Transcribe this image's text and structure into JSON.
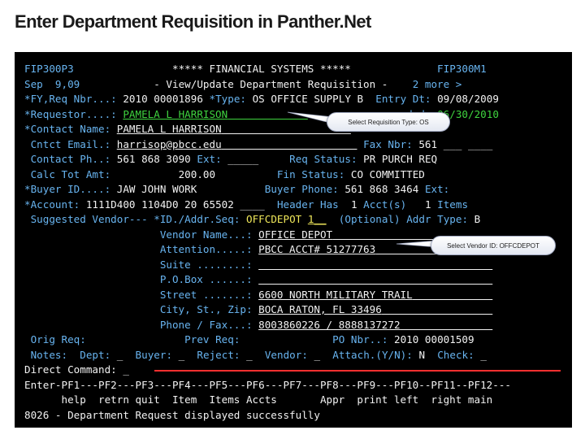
{
  "slide_title": "Enter Department Requisition in Panther.Net",
  "screen": {
    "line1": {
      "left": "FIP300P3",
      "title": "***** FINANCIAL SYSTEMS *****",
      "right": "FIP300M1"
    },
    "line2": {
      "date": "Sep  9,09",
      "title": "- View/Update Department Requisition -",
      "more": "2 more >"
    },
    "line3": {
      "label": "*FY,Req Nbr...:",
      "value": "2010 00001896",
      "type_label": "*Type:",
      "type_value": "OS OFFICE SUPPLY B",
      "entry_label": "Entry Dt:",
      "entry_value": "09/08/2009"
    },
    "line4": {
      "label": "*Requestor....:",
      "value": "PAMELA L HARRISON",
      "needed_label": "ded:",
      "needed_value": "06/30/2010"
    },
    "line5": {
      "label": "*Contact Name:",
      "value": "PAMELA L HARRISON"
    },
    "line6": {
      "label": "Cntct Email.:",
      "value": "harrisop@pbcc.edu",
      "fax_label": "Fax Nbr:",
      "fax_value": "561",
      "fax_blank1": "___",
      "fax_blank2": "____"
    },
    "line7": {
      "label": "Contact Ph..:",
      "value": "561 868 3090",
      "ext_label": "Ext:",
      "ext_value": "_____",
      "status_label": "Req Status:",
      "status_value": "PR PURCH REQ"
    },
    "line8": {
      "label": "Calc Tot Amt:",
      "value": "200.00",
      "fin_label": "Fin Status:",
      "fin_value": "CO COMMITTED"
    },
    "line9": {
      "label": "*Buyer ID....:",
      "value": "JAW",
      "buyer_name": "JOHN WORK",
      "phone_label": "Buyer Phone:",
      "phone_value": "561 868 3464",
      "ext_label": "Ext:"
    },
    "line10": {
      "label": "*Account:",
      "value": "1111D400 1104D0 20 65502",
      "blank": "____",
      "header_label": "Header Has",
      "acct_count": "1",
      "acct_label": "Acct(s)",
      "items_count": "1",
      "items_label": "Items"
    },
    "line11": {
      "label": "Suggested Vendor---",
      "id_label": "*ID./Addr.Seq:",
      "vendor_id": "OFFCDEPOT",
      "seq": "1",
      "seq_blank": "__",
      "optional": "(Optional)",
      "addr_type_label": "Addr Type:",
      "addr_type_value": "B"
    },
    "line12": {
      "label": "Vendor Name...:",
      "value": "OFFICE DEPOT"
    },
    "line13": {
      "label": "Attention.....:",
      "value": "PBCC ACCT# 51277763"
    },
    "line14": {
      "label": "Suite ........:",
      "value": ""
    },
    "line15": {
      "label": "P.O.Box ......:",
      "value": ""
    },
    "line16": {
      "label": "Street .......:",
      "value": "6600 NORTH MILITARY TRAIL"
    },
    "line17": {
      "label": "City, St., Zip:",
      "value": "BOCA RATON, FL 33496"
    },
    "line18": {
      "label": "Phone / Fax...:",
      "value": "8003860226 / 8888137272"
    },
    "line19": {
      "orig_label": "Orig Req:",
      "prev_label": "Prev Req:",
      "po_label": "PO Nbr..:",
      "po_value": "2010 00001509"
    },
    "line20": {
      "notes": "Notes:",
      "dept": "Dept:",
      "dept_value": "_",
      "buyer": "Buyer:",
      "buyer_value": "_",
      "reject": "Reject:",
      "reject_value": "_",
      "vendor": "Vendor:",
      "vendor_value": "_",
      "attach": "Attach.(Y/N):",
      "attach_value": "N",
      "check": "Check:",
      "check_value": "_"
    },
    "line21": {
      "label": "Direct Command:",
      "value": "_"
    },
    "line22": {
      "keys": "Enter-PF1---PF2---PF3---PF4---PF5---PF6---PF7---PF8---PF9---PF10--PF11--PF12---"
    },
    "line23": {
      "labels": "      help  retrn quit  Item  Items Accts       Appr  print left  right main"
    },
    "line24": {
      "message": "8026 - Department Request displayed successfully"
    }
  },
  "callouts": {
    "type": "Select Requisition Type: OS",
    "vendor": "Select Vendor ID: OFFCDEPOT"
  },
  "colors": {
    "terminal_bg": "#000000",
    "label": "#68b4f0",
    "value_white": "#f2f2f2",
    "value_green": "#3fd43f",
    "value_yellow": "#f0e85a",
    "alert_red": "#ff3030"
  }
}
